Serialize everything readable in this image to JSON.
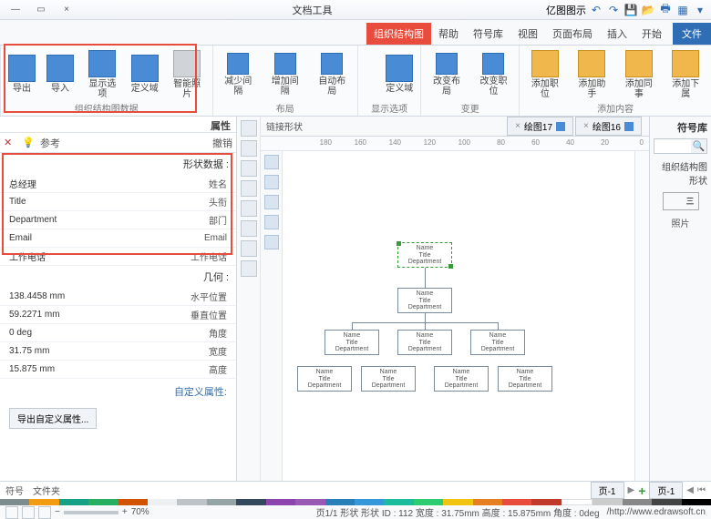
{
  "title_tools": "文档工具",
  "title_app": "亿图图示",
  "tabs": {
    "file": "文件",
    "items": [
      "开始",
      "插入",
      "页面布局",
      "视图",
      "符号库",
      "帮助",
      "组织结构图"
    ],
    "active": "组织结构图"
  },
  "ribbon": {
    "g1": {
      "label": "添加内容",
      "b1": "添加下属",
      "b2": "添加同事",
      "b3": "添加助手",
      "b4": "添加职位"
    },
    "g2": {
      "label": "变更",
      "b1": "改变职位",
      "b2": "改变布局"
    },
    "g3": {
      "label": "显示选项",
      "b1": "定义域"
    },
    "g4": {
      "label": "布局",
      "b1": "自动布局",
      "b2": "增加间隔",
      "b3": "减少间隔"
    },
    "g5": {
      "label": "组织结构图数据",
      "b1": "智能照片",
      "b2": "定义域",
      "b3": "显示选项",
      "b4": "导入",
      "b5": "导出"
    }
  },
  "right": {
    "title": "符号库",
    "search_ph": "",
    "lib": "组织结构图形状",
    "shape": "照片"
  },
  "doc_tabs": {
    "t1": "绘图16",
    "t2": "绘图17",
    "link": "链接形状"
  },
  "ruler": [
    "0",
    "20",
    "40",
    "60",
    "80",
    "100",
    "120",
    "140",
    "160",
    "180"
  ],
  "org": {
    "n": "Name",
    "t": "Title",
    "d": "Department"
  },
  "props": {
    "header": "属性",
    "hint": "参考",
    "undo": "撤销",
    "sec1": "形状数据 :",
    "rows1": [
      {
        "l": "姓名",
        "v": "总经理"
      },
      {
        "l": "头衔",
        "v": "Title"
      },
      {
        "l": "部门",
        "v": "Department"
      },
      {
        "l": "Email",
        "v": "Email"
      },
      {
        "l": "工作电话",
        "v": "工作电话"
      }
    ],
    "sec2": "几何 :",
    "rows2": [
      {
        "l": "水平位置",
        "v": "138.4458 mm"
      },
      {
        "l": "垂直位置",
        "v": "59.2271 mm"
      },
      {
        "l": "角度",
        "v": "0 deg"
      },
      {
        "l": "宽度",
        "v": "31.75 mm"
      },
      {
        "l": "高度",
        "v": "15.875 mm"
      }
    ],
    "custom_label": "自定义属性:",
    "custom_btn": "导出自定义属性..."
  },
  "pages": {
    "p1": "页-1",
    "p2": "页-1",
    "file_tab": "文件夹",
    "sym_tab": "符号"
  },
  "status": {
    "url": "http://www.edrawsoft.cn/",
    "info": "页1/1  形状  形状 ID : 112  宽度 : 31.75mm  高度 : 15.875mm  角度 : 0deg",
    "zoom": "70%"
  }
}
